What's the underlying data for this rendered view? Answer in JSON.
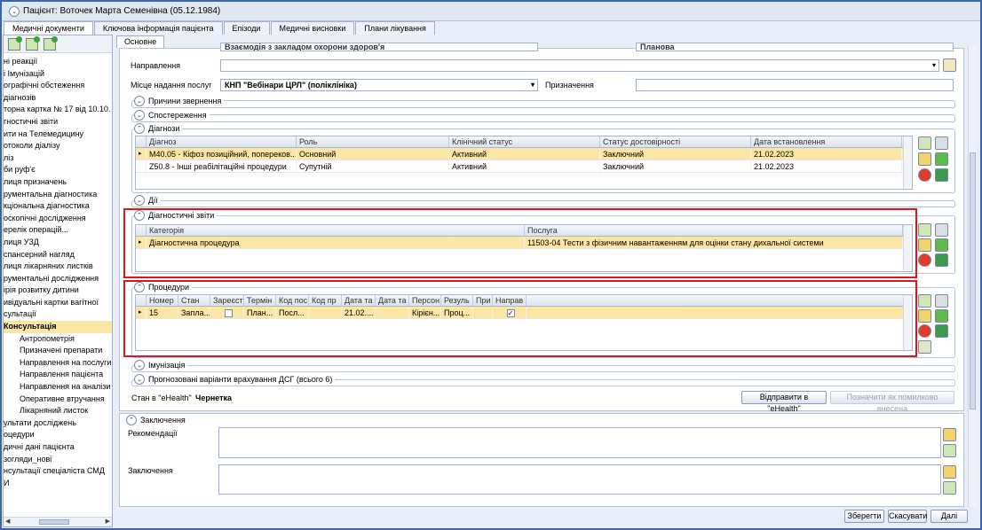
{
  "window": {
    "title": "Пацієнт: Воточек Марта Семенівна (05.12.1984)"
  },
  "tabs": [
    "Медичні документи",
    "Ключова інформація пацієнта",
    "Епізоди",
    "Медичні висновки",
    "Плани лікування"
  ],
  "subtab": "Основне",
  "nav": {
    "items": [
      "ні реакції",
      "і Імунізацій",
      "ографічні обстеження",
      "діагнозів",
      "торна картка № 17 від 10.10.",
      "гностичні звіти",
      "ити на Телемедицину",
      "отоколи діалізу",
      "ліз",
      "би руф'є",
      "лиця призначень",
      "рументальна діагностика",
      "кціональна діагностика",
      "оскопічні дослідження",
      "ерелік операцій...",
      "лиця УЗД",
      "спансерний нагляд",
      "лиця лікарняних листків",
      "рументальні дослідження",
      "ірія розвитку дитини",
      "ивідуальні картки вагітної",
      "сультації"
    ],
    "active": "Консультація",
    "subitems": [
      "Антропометрія",
      "Призначені препарати",
      "Направлення на послуги",
      "Направлення пацієнта",
      "Направлення на аналізи",
      "Оперативне втручання",
      "Лікарняний листок"
    ],
    "after": [
      "ультати досліджень",
      "оцедури",
      "дичні дані пацієнта",
      "зогляди_нові",
      "нсультації спеціаліста СМД",
      "И"
    ]
  },
  "form": {
    "top_value_left": "Взаємодія з закладом охорони здоров'я",
    "top_value_right": "Планова",
    "direction_label": "Направлення",
    "direction_value": "",
    "place_label": "Місце надання послуг",
    "place_value": "КНП \"Вебінари ЦРЛ\" (поліклініка)",
    "assignment_label": "Призначення",
    "assignment_value": ""
  },
  "sections": {
    "reasons": "Причини звернення",
    "observations": "Спостереження",
    "diagnoses": "Діагнози",
    "actions": "Дії",
    "diag_reports": "Діагностичні звіти",
    "procedures": "Процедури",
    "immunization": "Імунізація",
    "forecast": "Прогнозовані варіанти врахування ДСГ (всього 6)",
    "conclusion": "Заключення"
  },
  "diagnoses": {
    "columns": [
      "Діагноз",
      "Роль",
      "Клінічний статус",
      "Статус достовірності",
      "Дата встановлення"
    ],
    "rows": [
      [
        "M40.05 - Кіфоз позиційний, поперeков...",
        "Основний",
        "Активний",
        "Заключний",
        "21.02.2023"
      ],
      [
        "Z50.8 - Інші реабілітаційні процедури",
        "Супутній",
        "Активний",
        "Заключний",
        "21.02.2023"
      ]
    ]
  },
  "diag_reports": {
    "columns": [
      "Категорія",
      "Послуга"
    ],
    "rows": [
      [
        "Діагностична процедура",
        "11503-04 Тести з фізичним навантаженням для оцінки стану дихальної системи"
      ]
    ]
  },
  "procedures": {
    "columns": [
      "Номер",
      "Стан",
      "Зареєст",
      "Термін",
      "Код пос",
      "Код пр",
      "Дата та",
      "Дата та",
      "Персон",
      "Резуль",
      "При",
      "Направ"
    ],
    "rows": [
      [
        "15",
        "Запла...",
        "",
        "План...",
        "Посл...",
        "",
        "21.02....",
        "",
        "Кірієн...",
        "Проц...",
        "",
        ""
      ]
    ],
    "registered_checked": false,
    "direction_checked": true
  },
  "ehealth": {
    "status_label": "Стан в \"eHealth\"",
    "status_value": "Чернетка",
    "send_button": "Відправити в \"eHealth\"",
    "mark_error_button": "Позначити як помилково внесена"
  },
  "conclusion": {
    "recommendations_label": "Рекомендації",
    "conclusion_label": "Заключення"
  },
  "footer": {
    "save": "Зберегти",
    "cancel": "Скасувати",
    "next": "Далі"
  }
}
